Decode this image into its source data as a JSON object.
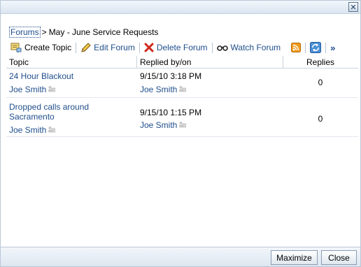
{
  "window": {
    "close_icon": "close-x-icon"
  },
  "breadcrumb": {
    "parent": "Forums",
    "separator": ">",
    "current": "May - June Service Requests"
  },
  "toolbar": {
    "create_topic": "Create Topic",
    "edit_forum": "Edit Forum",
    "delete_forum": "Delete Forum",
    "watch_forum": "Watch Forum",
    "more": "»"
  },
  "table": {
    "headers": {
      "topic": "Topic",
      "replied": "Replied by/on",
      "replies": "Replies"
    },
    "rows": [
      {
        "topic_line1": "24 Hour Blackout",
        "topic_line2": "",
        "author": "Joe Smith",
        "date": "9/15/10 3:18 PM",
        "replied_by": "Joe Smith",
        "replies": "0"
      },
      {
        "topic_line1": "Dropped calls around",
        "topic_line2": "Sacramento",
        "author": "Joe Smith",
        "date": "9/15/10 1:15 PM",
        "replied_by": "Joe Smith",
        "replies": "0"
      }
    ]
  },
  "footer": {
    "maximize": "Maximize",
    "close": "Close"
  },
  "colors": {
    "link": "#1f4e8c",
    "chrome": "#dbe5f0",
    "rss": "#f09a1a",
    "delete": "#d0271c"
  }
}
